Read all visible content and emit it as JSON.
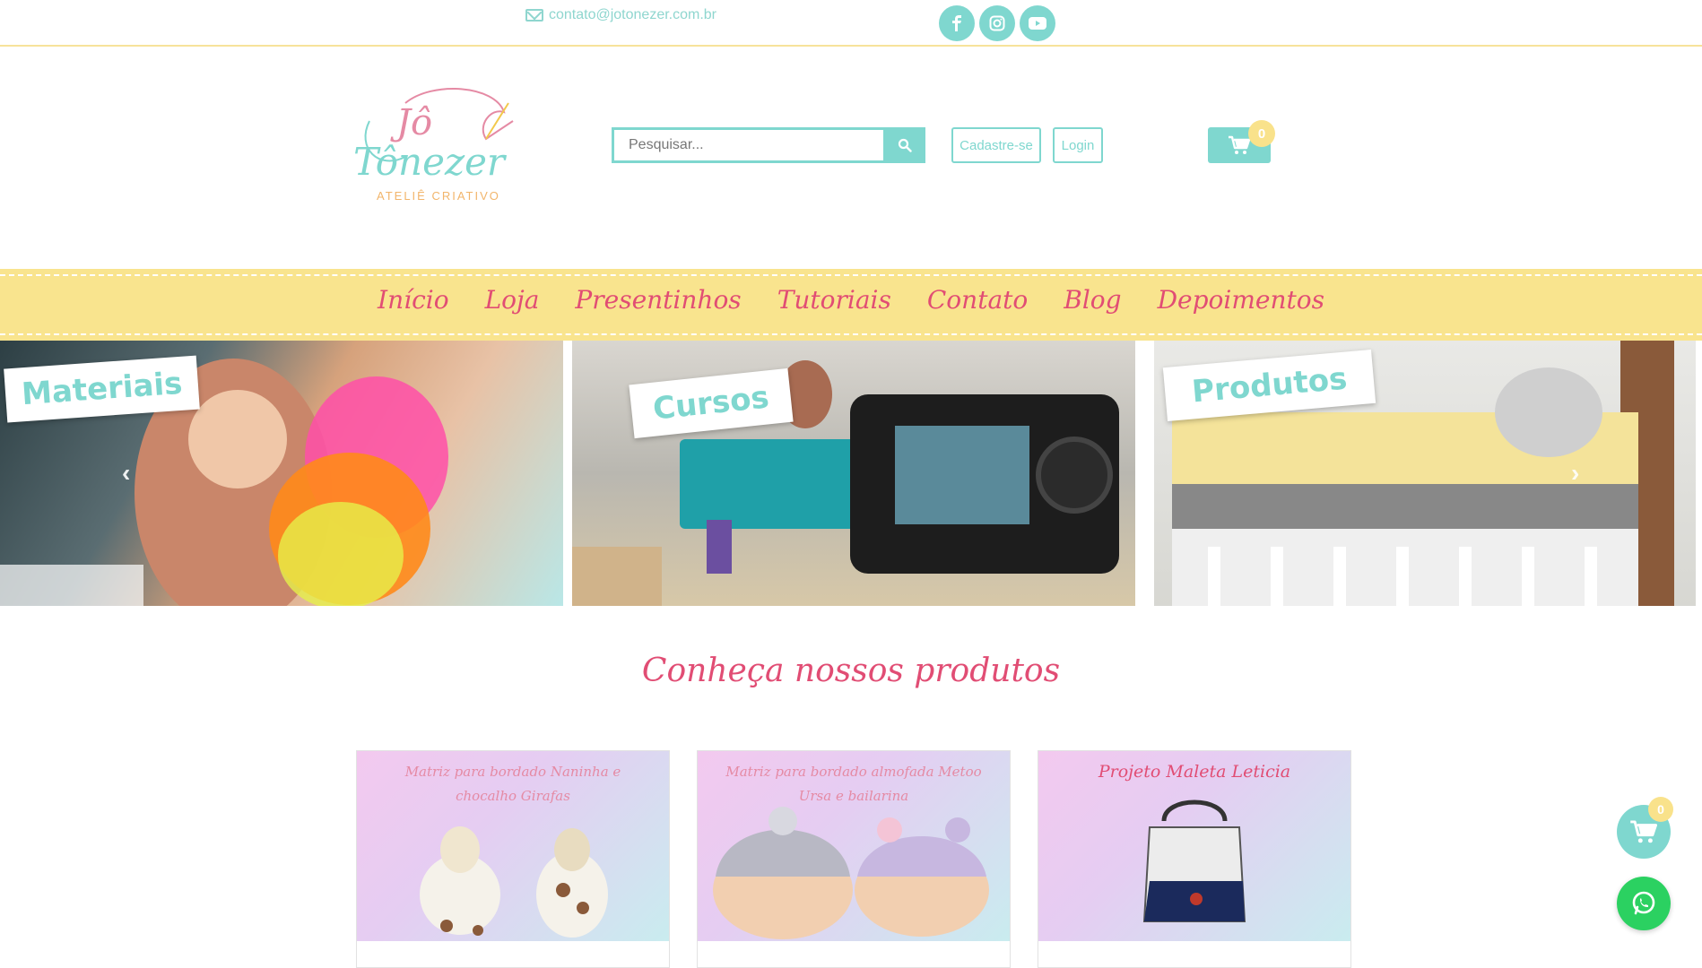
{
  "topbar": {
    "email": "contato@jotonezer.com.br",
    "social": [
      {
        "icon": "facebook-icon",
        "glyph": "f"
      },
      {
        "icon": "instagram-icon",
        "glyph": "◎"
      },
      {
        "icon": "youtube-icon",
        "glyph": "▶"
      }
    ]
  },
  "logo": {
    "line1": "Jô",
    "line2": "Tônezer",
    "subtitle": "ATELIÊ CRIATIVO"
  },
  "search": {
    "placeholder": "Pesquisar..."
  },
  "account": {
    "register_label": "Cadastre-se",
    "login_label": "Login"
  },
  "cart": {
    "count": "0"
  },
  "nav": {
    "items": [
      "Início",
      "Loja",
      "Presentinhos",
      "Tutoriais",
      "Contato",
      "Blog",
      "Depoimentos"
    ]
  },
  "banners": [
    {
      "label": "Materiais"
    },
    {
      "label": "Cursos"
    },
    {
      "label": "Produtos"
    }
  ],
  "carousel": {
    "prev": "‹",
    "next": "›"
  },
  "section": {
    "title": "Conheça nossos produtos"
  },
  "products": [
    {
      "title": "Matriz para bordado Naninha e chocalho Girafas"
    },
    {
      "title": "Matriz para bordado almofada Metoo Ursa e bailarina"
    },
    {
      "title": "Projeto Maleta Leticia"
    }
  ],
  "floating": {
    "cart_count": "0"
  },
  "colors": {
    "accent": "#7fd7cf",
    "nav_bg": "#f9e48e",
    "pink": "#e14d74",
    "badge": "#f9e28b",
    "whatsapp": "#2bd161"
  }
}
